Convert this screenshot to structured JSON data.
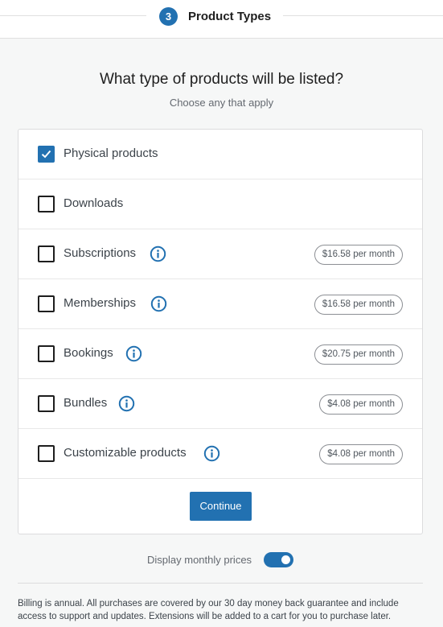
{
  "stepper": {
    "number": "3",
    "title": "Product Types"
  },
  "heading": "What type of products will be listed?",
  "subheading": "Choose any that apply",
  "options": [
    {
      "label": "Physical products",
      "checked": true,
      "info": false,
      "price": ""
    },
    {
      "label": "Downloads",
      "checked": false,
      "info": false,
      "price": ""
    },
    {
      "label": "Subscriptions",
      "checked": false,
      "info": true,
      "price": "$16.58 per month"
    },
    {
      "label": "Memberships",
      "checked": false,
      "info": true,
      "price": "$16.58 per month"
    },
    {
      "label": "Bookings",
      "checked": false,
      "info": true,
      "price": "$20.75 per month"
    },
    {
      "label": "Bundles",
      "checked": false,
      "info": true,
      "price": "$4.08 per month"
    },
    {
      "label": "Customizable products",
      "checked": false,
      "info": true,
      "price": "$4.08 per month"
    }
  ],
  "continue_label": "Continue",
  "toggle": {
    "label": "Display monthly prices",
    "on": true
  },
  "footnote": "Billing is annual. All purchases are covered by our 30 day money back guarantee and include access to support and updates. Extensions will be added to a cart for you to purchase later.",
  "colors": {
    "accent": "#2271b1",
    "background": "#f6f7f7"
  },
  "icons": {
    "check": "checkmark-icon",
    "info": "info-icon"
  }
}
